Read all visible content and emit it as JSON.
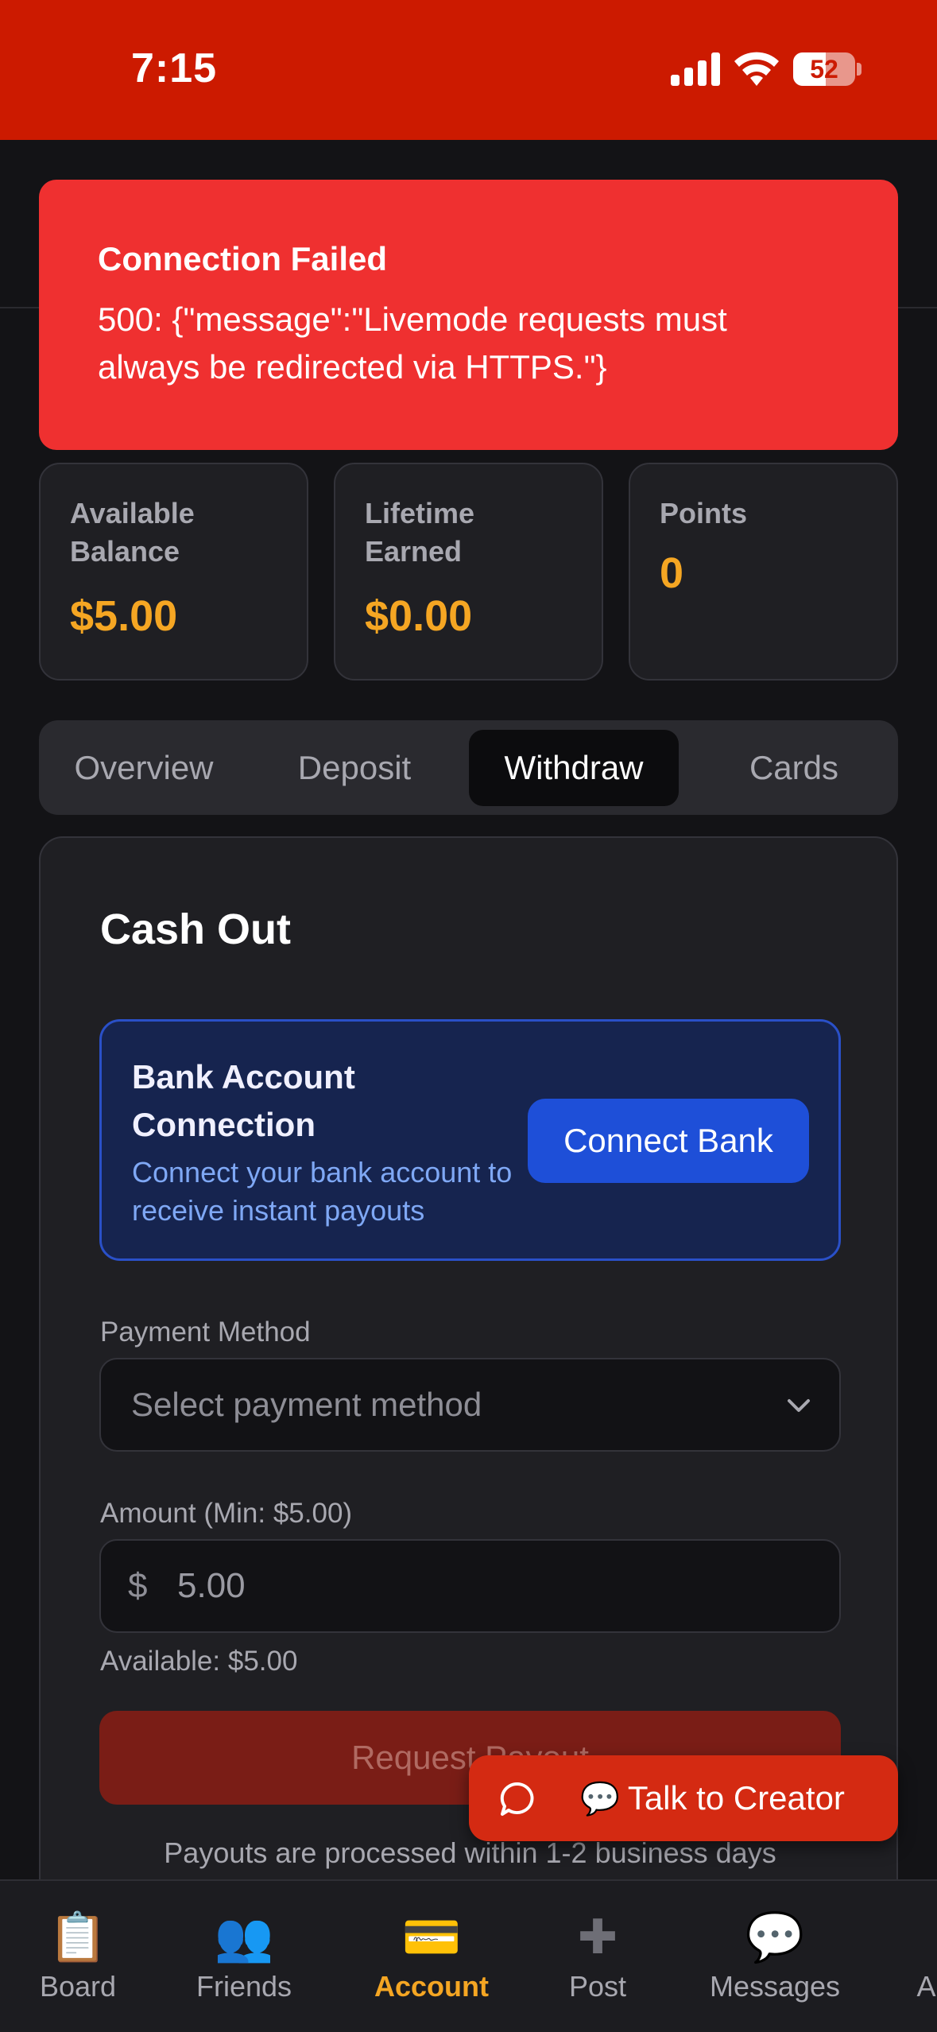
{
  "status_bar": {
    "time": "7:15",
    "battery_level": "52",
    "battery_fraction": 0.52,
    "icons": [
      "cellular-signal-icon",
      "wifi-icon",
      "battery-icon"
    ]
  },
  "toast": {
    "title": "Connection Failed",
    "message": "500: {\"message\":\"Livemode requests must always be redirected via HTTPS.\"}"
  },
  "stats": [
    {
      "label": "Available Balance",
      "value": "$5.00"
    },
    {
      "label": "Lifetime Earned",
      "value": "$0.00"
    },
    {
      "label": "Points",
      "value": "0"
    }
  ],
  "tabs": [
    {
      "label": "Overview",
      "active": false
    },
    {
      "label": "Deposit",
      "active": false
    },
    {
      "label": "Withdraw",
      "active": true
    },
    {
      "label": "Cards",
      "active": false
    }
  ],
  "withdraw": {
    "title": "Cash Out",
    "bank": {
      "title": "Bank Account Connection",
      "subtitle": "Connect your bank account to receive instant payouts",
      "button_label": "Connect Bank"
    },
    "payment_method": {
      "label": "Payment Method",
      "placeholder": "Select payment method"
    },
    "amount": {
      "label": "Amount (Min: $5.00)",
      "currency_symbol": "$",
      "value": "5.00"
    },
    "available_note": "Available: $5.00",
    "submit_label": "Request Payout",
    "footer_note": "Payouts are processed within 1-2 business days"
  },
  "chat_fab": {
    "emoji": "💬",
    "label": "Talk to Creator"
  },
  "bottom_nav": [
    {
      "icon": "📋",
      "label": "Board",
      "active": false
    },
    {
      "icon": "👥",
      "label": "Friends",
      "active": false
    },
    {
      "icon": "💳",
      "label": "Account",
      "active": true
    },
    {
      "icon": "➕",
      "label": "Post",
      "active": false
    },
    {
      "icon": "💬",
      "label": "Messages",
      "active": false
    },
    {
      "icon": "",
      "label": "A",
      "active": false
    }
  ],
  "colors": {
    "status_bar": "#cc1a00",
    "background": "#131316",
    "accent": "#f5a623",
    "error": "#ef3030",
    "bank_blue": "#1e4fd8"
  }
}
